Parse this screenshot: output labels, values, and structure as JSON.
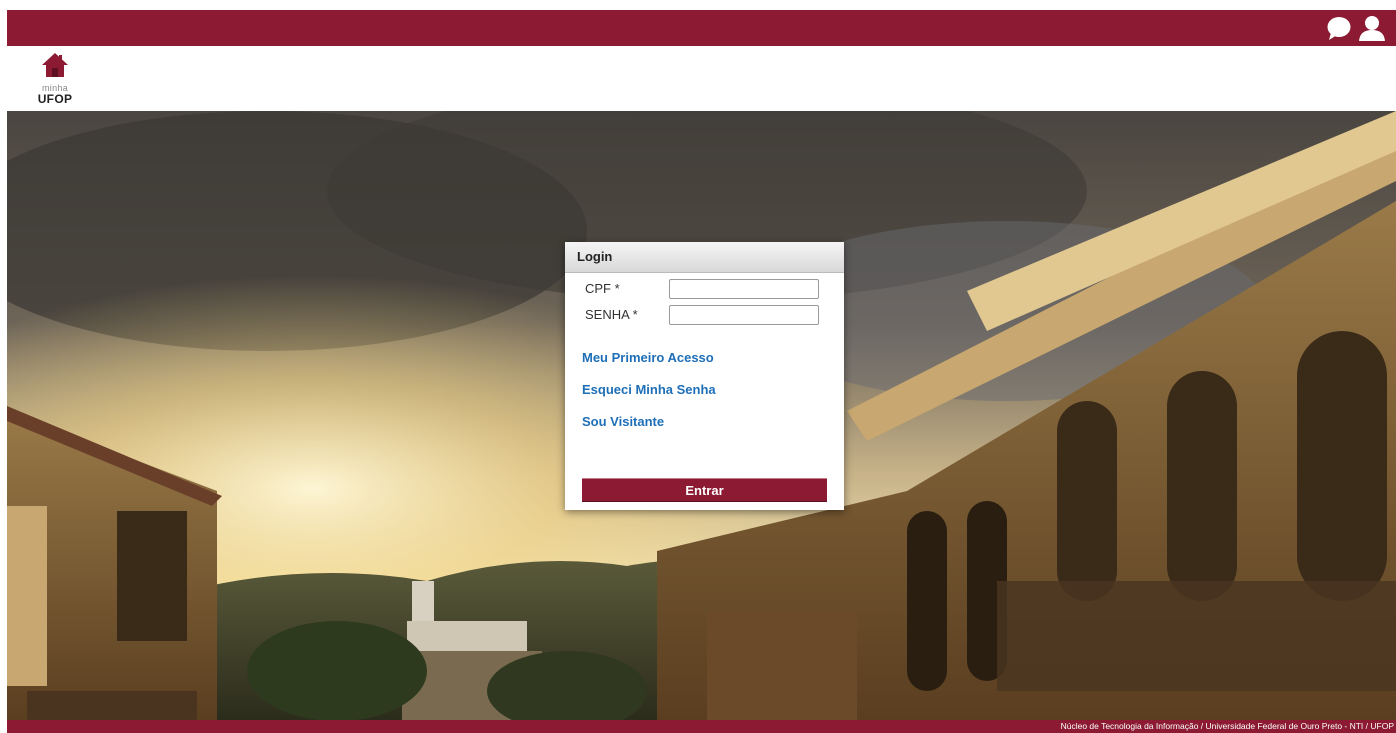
{
  "header": {
    "logo_top": "minha",
    "logo_bottom": "UFOP"
  },
  "topbar": {
    "icons": [
      "chat-icon",
      "user-icon"
    ]
  },
  "login": {
    "title": "Login",
    "cpf_label": "CPF *",
    "cpf_value": "",
    "senha_label": "SENHA *",
    "senha_value": "",
    "links": {
      "first_access": "Meu Primeiro Acesso",
      "forgot_password": "Esqueci Minha Senha",
      "visitor": "Sou Visitante"
    },
    "submit_label": "Entrar"
  },
  "footer": {
    "text": "Núcleo de Tecnologia da Informação / Universidade Federal de Ouro Preto - NTI / UFOP"
  },
  "colors": {
    "brand": "#8b1a32",
    "link": "#1e6fb8"
  }
}
